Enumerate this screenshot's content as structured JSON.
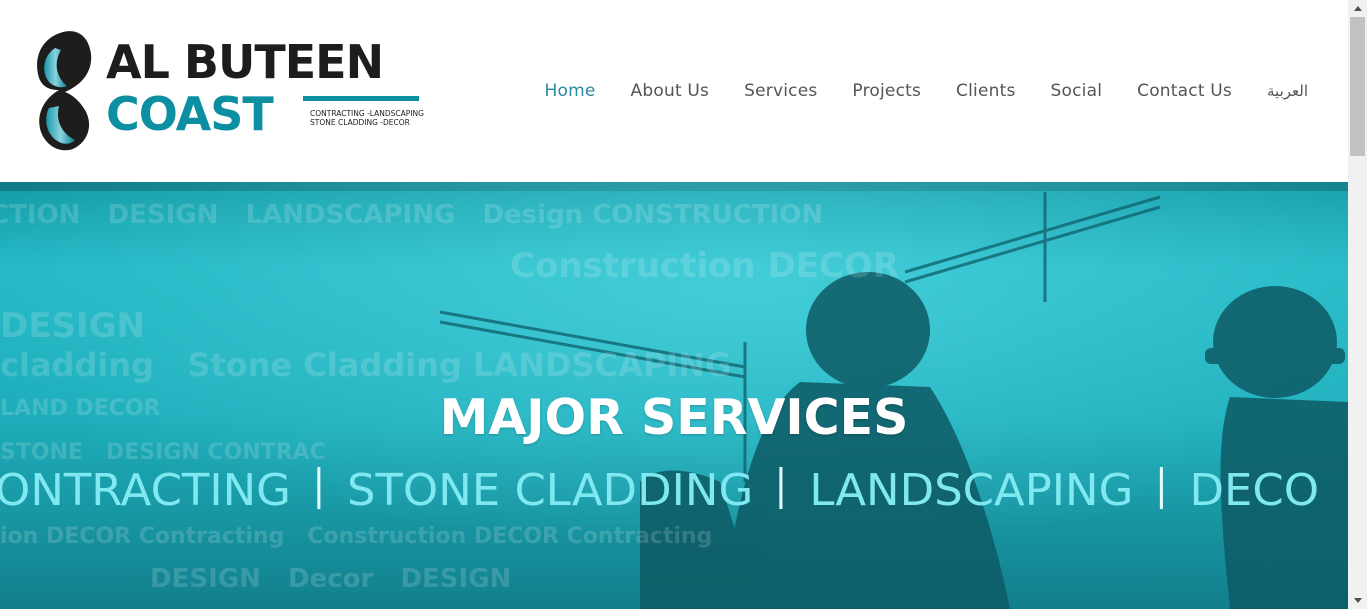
{
  "header": {
    "logo": {
      "line1": "AL BUTEEN",
      "line2": "COAST",
      "tagline1": "CONTRACTING -LANDSCAPING",
      "tagline2": "STONE CLADDING -DECOR"
    },
    "nav": [
      {
        "label": "Home",
        "active": true
      },
      {
        "label": "About Us",
        "active": false
      },
      {
        "label": "Services",
        "active": false
      },
      {
        "label": "Projects",
        "active": false
      },
      {
        "label": "Clients",
        "active": false
      },
      {
        "label": "Social",
        "active": false
      },
      {
        "label": "Contact Us",
        "active": false
      },
      {
        "label": "العربية",
        "active": false
      }
    ]
  },
  "hero": {
    "title": "MAJOR SERVICES",
    "services": [
      "ONTRACTING",
      "STONE CLADDING",
      "LANDSCAPING",
      "DECO"
    ]
  },
  "colors": {
    "brand_dark": "#1d1d1b",
    "brand_teal": "#0c8fa0",
    "nav_active": "#2a8aa0",
    "nav_text": "#555555",
    "hero_bg": "#1eaebb"
  },
  "icons": {
    "scroll_up": "triangle-up-icon",
    "scroll_down": "triangle-down-icon"
  }
}
